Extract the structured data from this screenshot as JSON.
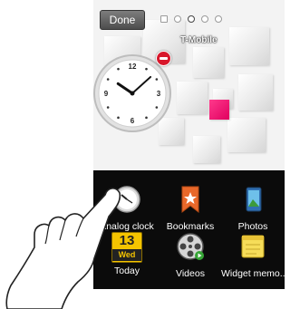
{
  "status": {
    "done_label": "Done",
    "carrier": "T-Mobile",
    "pages": 5,
    "active_page": 3
  },
  "colors": {
    "accent_pink": "#e0005f",
    "drawer_bg": "#0b0b0b",
    "remove_red": "#d8172b"
  },
  "clock": {
    "type": "analog",
    "numbers": [
      "12",
      "3",
      "6",
      "9"
    ],
    "hour": 10,
    "minute": 8
  },
  "apps": [
    {
      "label": "Analog clock",
      "icon": "analog-clock-icon"
    },
    {
      "label": "Bookmarks",
      "icon": "bookmark-star-icon"
    },
    {
      "label": "Photos",
      "icon": "photos-icon"
    },
    {
      "label": "Today",
      "icon": "calendar-icon",
      "day": "13",
      "weekday": "Wed"
    },
    {
      "label": "Videos",
      "icon": "film-reel-icon"
    },
    {
      "label": "Widget memo...",
      "icon": "memo-note-icon"
    }
  ]
}
